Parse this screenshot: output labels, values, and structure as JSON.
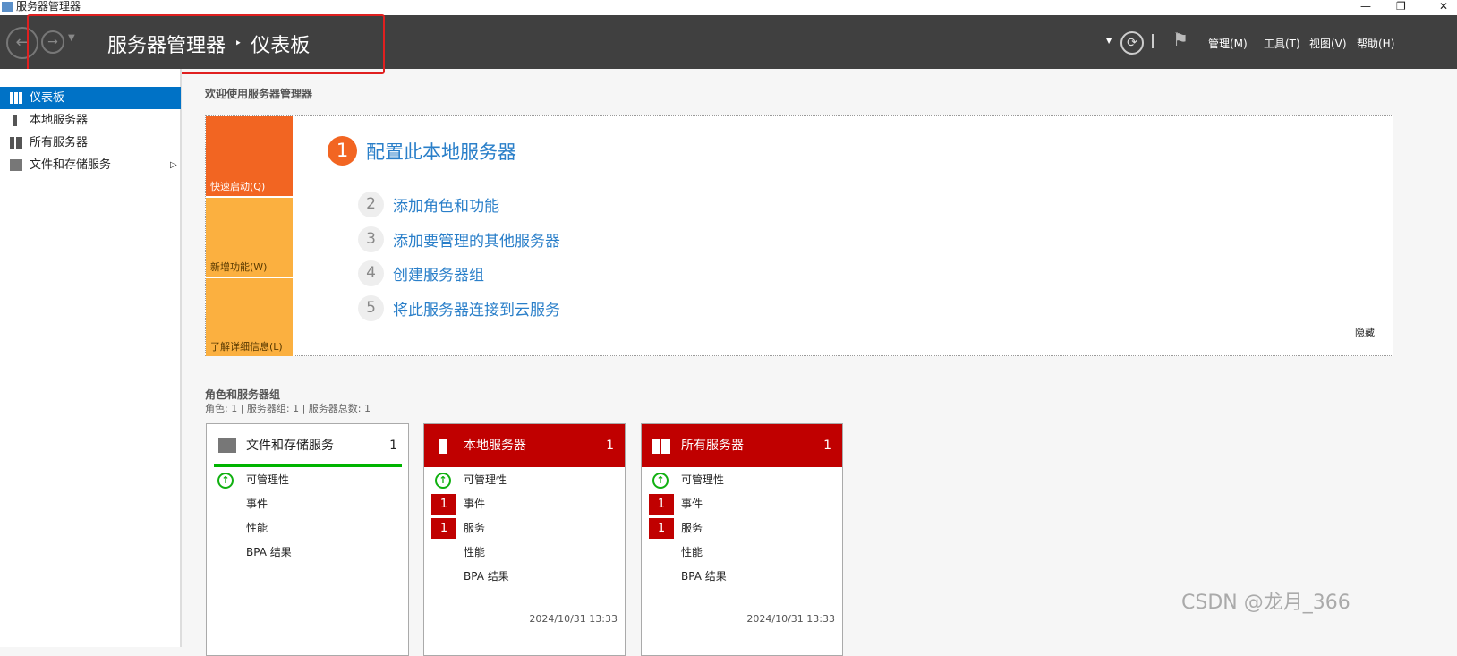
{
  "window": {
    "title": "服务器管理器",
    "minimize": "—",
    "restore": "❐",
    "close": "✕"
  },
  "header": {
    "breadcrumb_root": "服务器管理器",
    "breadcrumb_sep": "‣",
    "breadcrumb_current": "仪表板",
    "menus": [
      "管理(M)",
      "工具(T)",
      "视图(V)",
      "帮助(H)"
    ]
  },
  "sidebar": {
    "items": [
      {
        "label": "仪表板",
        "selected": true
      },
      {
        "label": "本地服务器"
      },
      {
        "label": "所有服务器"
      },
      {
        "label": "文件和存储服务",
        "expand": "▷"
      }
    ]
  },
  "welcome": {
    "heading": "欢迎使用服务器管理器",
    "tiles": [
      "快速启动(Q)",
      "新增功能(W)",
      "了解详细信息(L)"
    ],
    "steps": [
      {
        "n": "1",
        "label": "配置此本地服务器"
      },
      {
        "n": "2",
        "label": "添加角色和功能"
      },
      {
        "n": "3",
        "label": "添加要管理的其他服务器"
      },
      {
        "n": "4",
        "label": "创建服务器组"
      },
      {
        "n": "5",
        "label": "将此服务器连接到云服务"
      }
    ],
    "hide": "隐藏"
  },
  "groups": {
    "heading": "角色和服务器组",
    "summary": "角色: 1 | 服务器组: 1 | 服务器总数: 1",
    "cards": [
      {
        "title": "文件和存储服务",
        "count": "1",
        "rows": [
          "可管理性",
          "事件",
          "性能",
          "BPA 结果"
        ]
      },
      {
        "title": "本地服务器",
        "count": "1",
        "rows": [
          "可管理性",
          "事件",
          "服务",
          "性能",
          "BPA 结果"
        ],
        "badges": [
          "1",
          "1"
        ],
        "timestamp": "2024/10/31 13:33"
      },
      {
        "title": "所有服务器",
        "count": "1",
        "rows": [
          "可管理性",
          "事件",
          "服务",
          "性能",
          "BPA 结果"
        ],
        "badges": [
          "1",
          "1"
        ],
        "timestamp": "2024/10/31 13:33"
      }
    ]
  },
  "watermark": "CSDN @龙月_366",
  "colors": {
    "accent": "#0072c6",
    "orange": "#f26522",
    "yellow": "#fbb040",
    "alert": "#c00000",
    "ok": "#10b010"
  }
}
